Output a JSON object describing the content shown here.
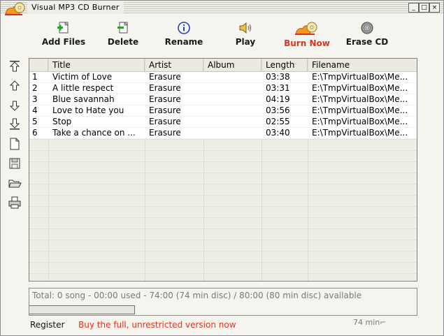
{
  "window": {
    "title": "Visual MP3 CD Burner",
    "min": "_",
    "max": "□",
    "close": "×"
  },
  "toolbar": {
    "add": {
      "label": "Add Files",
      "icon": "add-files-icon"
    },
    "delete": {
      "label": "Delete",
      "icon": "delete-icon"
    },
    "rename": {
      "label": "Rename",
      "icon": "info-icon"
    },
    "play": {
      "label": "Play",
      "icon": "speaker-icon"
    },
    "burn": {
      "label": "Burn Now",
      "icon": "burn-cd-icon",
      "color": "#e8301c"
    },
    "erase": {
      "label": "Erase CD",
      "icon": "disc-icon"
    }
  },
  "side_tools": [
    "move-top-icon",
    "move-up-icon",
    "move-down-icon",
    "move-bottom-icon",
    "new-list-icon",
    "save-list-icon",
    "open-folder-icon",
    "print-icon"
  ],
  "list": {
    "columns": [
      "",
      "Title",
      "Artist",
      "Album",
      "Length",
      "Filename"
    ],
    "rows": [
      [
        "1",
        "Victim of Love",
        "Erasure",
        "",
        "03:38",
        "E:\\TmpVirtualBox\\Me..."
      ],
      [
        "2",
        "A little respect",
        "Erasure",
        "",
        "03:31",
        "E:\\TmpVirtualBox\\Me..."
      ],
      [
        "3",
        "Blue savannah",
        "Erasure",
        "",
        "04:19",
        "E:\\TmpVirtualBox\\Me..."
      ],
      [
        "4",
        "Love to Hate you",
        "Erasure",
        "",
        "03:56",
        "E:\\TmpVirtualBox\\Me..."
      ],
      [
        "5",
        "Stop",
        "Erasure",
        "",
        "02:55",
        "E:\\TmpVirtualBox\\Me..."
      ],
      [
        "6",
        "Take a chance on ...",
        "Erasure",
        "",
        "03:40",
        "E:\\TmpVirtualBox\\Me..."
      ]
    ]
  },
  "status": {
    "text": "Total: 0 song - 00:00 used - 74:00 (74 min disc) / 80:00 (80 min disc) available",
    "progress": 0
  },
  "footer": {
    "register": "Register",
    "buy": "Buy the full, unrestricted version now",
    "disc_size": "74 min",
    "disc_size_arrow": "⌐"
  }
}
